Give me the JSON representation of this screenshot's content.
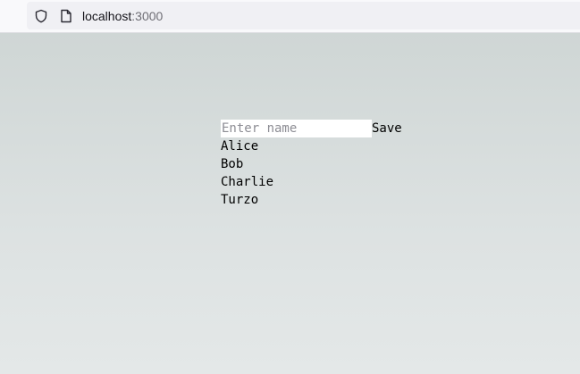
{
  "browser": {
    "url_host": "localhost",
    "url_port": ":3000"
  },
  "form": {
    "input_placeholder": "Enter name",
    "input_value": "",
    "save_label": "Save"
  },
  "names": [
    {
      "label": "Alice"
    },
    {
      "label": "Bob"
    },
    {
      "label": "Charlie"
    },
    {
      "label": "Turzo"
    }
  ],
  "colors": {
    "page_gradient_top": "#cfd6d5",
    "page_gradient_bottom": "#e4e8e8",
    "url_bar": "#f0f0f4"
  },
  "icons": [
    "shield-icon",
    "page-icon"
  ]
}
